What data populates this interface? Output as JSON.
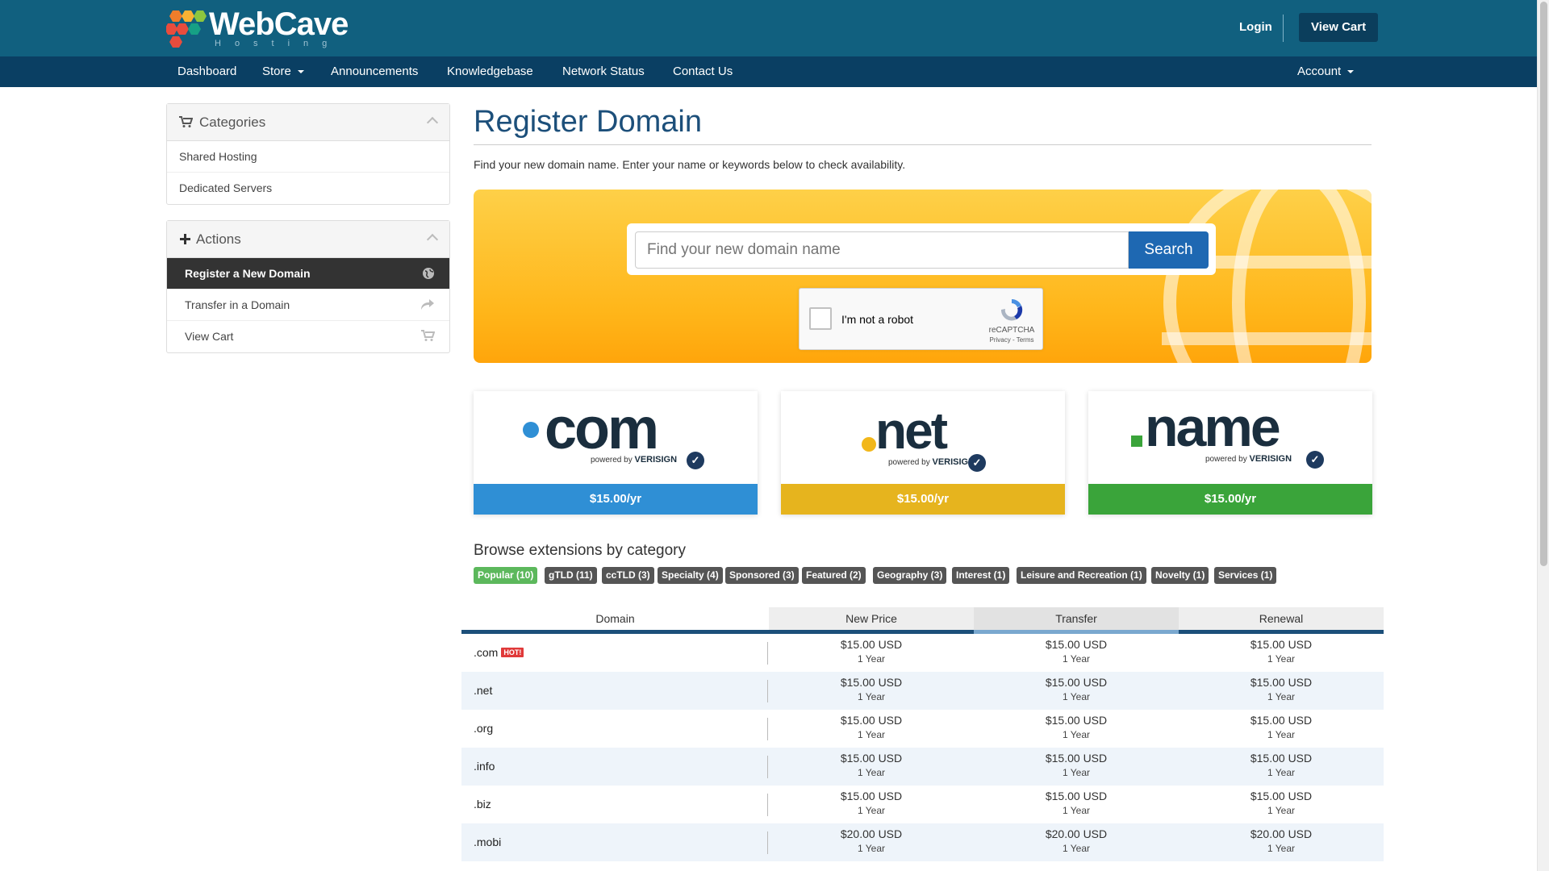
{
  "header": {
    "brand": "WebCave",
    "brand_sub": "Hosting",
    "login": "Login",
    "view_cart": "View Cart"
  },
  "nav": {
    "items": [
      "Dashboard",
      "Store",
      "Announcements",
      "Knowledgebase",
      "Network Status",
      "Contact Us"
    ],
    "account": "Account"
  },
  "sidebar": {
    "categories_title": "Categories",
    "categories": [
      "Shared Hosting",
      "Dedicated Servers"
    ],
    "actions_title": "Actions",
    "actions": [
      "Register a New Domain",
      "Transfer in a Domain",
      "View Cart"
    ]
  },
  "main": {
    "title": "Register Domain",
    "intro": "Find your new domain name. Enter your name or keywords below to check availability.",
    "search_placeholder": "Find your new domain name",
    "search_button": "Search",
    "captcha_label": "I'm not a robot",
    "captcha_brand": "reCAPTCHA",
    "captcha_terms": "Privacy - Terms"
  },
  "tld_cards": [
    {
      "tld": "com",
      "price": "$15.00/yr",
      "color": "#2f8fd5",
      "dot": "#2f8fd5"
    },
    {
      "tld": "net",
      "price": "$15.00/yr",
      "color": "#e6b41e",
      "dot": "#f2b71a"
    },
    {
      "tld": "name",
      "price": "$15.00/yr",
      "color": "#3aa43a",
      "dot": "#3aa43a"
    }
  ],
  "powered_by": "powered by",
  "verisign": "VERISIGN",
  "browse_title": "Browse extensions by category",
  "categories": [
    "Popular (10)",
    "gTLD (11)",
    "ccTLD (3)",
    "Specialty (4)",
    "Sponsored (3)",
    "Featured (2)",
    "Geography (3)",
    "Interest (1)",
    "Leisure and Recreation (1)",
    "Novelty (1)",
    "Services (1)"
  ],
  "table": {
    "headers": [
      "Domain",
      "New Price",
      "Transfer",
      "Renewal"
    ],
    "hot_label": "HOT!",
    "rows": [
      {
        "domain": ".com",
        "new": "$15.00 USD",
        "transfer": "$15.00 USD",
        "renewal": "$15.00 USD",
        "period": "1 Year"
      },
      {
        "domain": ".net",
        "new": "$15.00 USD",
        "transfer": "$15.00 USD",
        "renewal": "$15.00 USD",
        "period": "1 Year"
      },
      {
        "domain": ".org",
        "new": "$15.00 USD",
        "transfer": "$15.00 USD",
        "renewal": "$15.00 USD",
        "period": "1 Year"
      },
      {
        "domain": ".info",
        "new": "$15.00 USD",
        "transfer": "$15.00 USD",
        "renewal": "$15.00 USD",
        "period": "1 Year"
      },
      {
        "domain": ".biz",
        "new": "$15.00 USD",
        "transfer": "$15.00 USD",
        "renewal": "$15.00 USD",
        "period": "1 Year"
      },
      {
        "domain": ".mobi",
        "new": "$20.00 USD",
        "transfer": "$20.00 USD",
        "renewal": "$20.00 USD",
        "period": "1 Year"
      }
    ]
  }
}
